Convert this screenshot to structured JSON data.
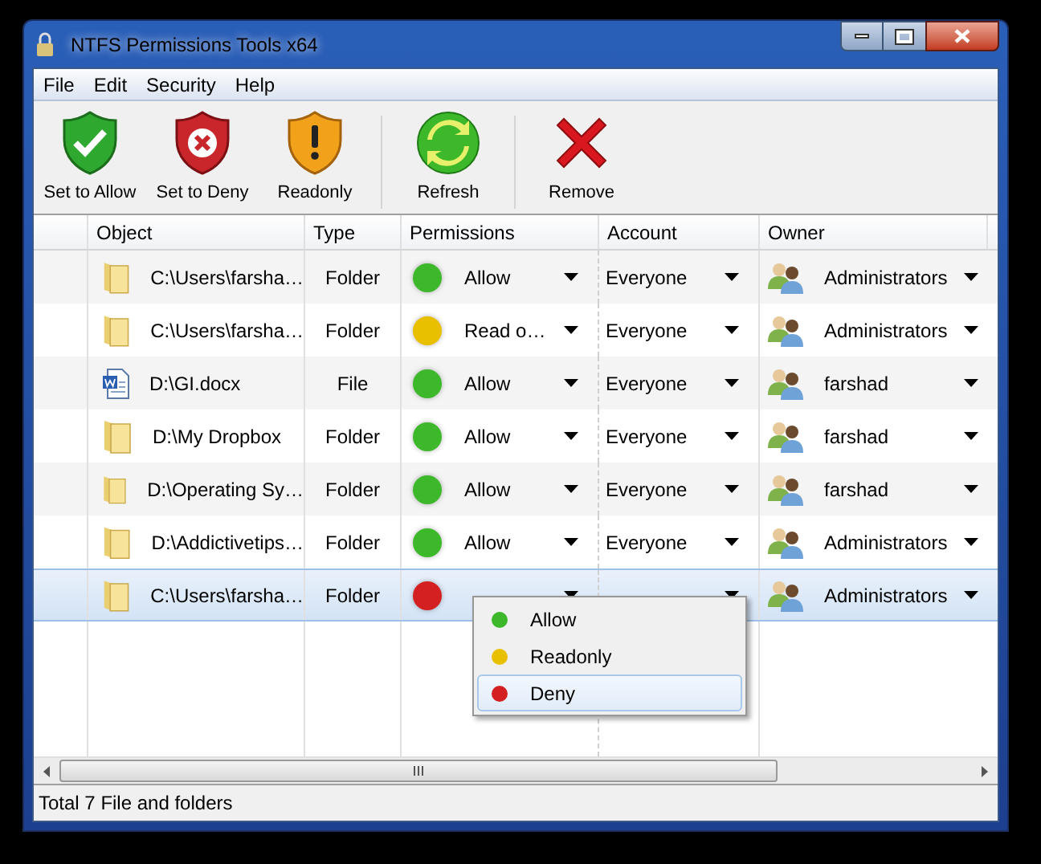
{
  "window": {
    "title": "NTFS Permissions Tools x64"
  },
  "menu": [
    "File",
    "Edit",
    "Security",
    "Help"
  ],
  "toolbar": [
    {
      "kind": "allow",
      "label": "Set to Allow"
    },
    {
      "kind": "deny",
      "label": "Set to Deny"
    },
    {
      "kind": "readonly",
      "label": "Readonly"
    },
    {
      "kind": "refresh",
      "label": "Refresh"
    },
    {
      "kind": "remove",
      "label": "Remove"
    }
  ],
  "table": {
    "columns": [
      "Object",
      "Type",
      "Permissions",
      "Account",
      "Owner"
    ],
    "rows": [
      {
        "kind": "folder",
        "object": "C:\\Users\\farsha…",
        "type": "Folder",
        "permission": "Allow",
        "color": "#3cb82a",
        "account": "Everyone",
        "owner": "Administrators",
        "selected": false
      },
      {
        "kind": "folder",
        "object": "C:\\Users\\farsha…",
        "type": "Folder",
        "permission": "Read o…",
        "color": "#e8c000",
        "account": "Everyone",
        "owner": "Administrators",
        "selected": false
      },
      {
        "kind": "document",
        "object": "D:\\GI.docx",
        "type": "File",
        "permission": "Allow",
        "color": "#3cb82a",
        "account": "Everyone",
        "owner": "farshad",
        "selected": false
      },
      {
        "kind": "folder",
        "object": "D:\\My Dropbox",
        "type": "Folder",
        "permission": "Allow",
        "color": "#3cb82a",
        "account": "Everyone",
        "owner": "farshad",
        "selected": false
      },
      {
        "kind": "folder",
        "object": "D:\\Operating Sy…",
        "type": "Folder",
        "permission": "Allow",
        "color": "#3cb82a",
        "account": "Everyone",
        "owner": "farshad",
        "selected": false
      },
      {
        "kind": "folder",
        "object": "D:\\Addictivetips…",
        "type": "Folder",
        "permission": "Allow",
        "color": "#3cb82a",
        "account": "Everyone",
        "owner": "Administrators",
        "selected": false
      },
      {
        "kind": "folder",
        "object": "C:\\Users\\farsha…",
        "type": "Folder",
        "color": "#d42020",
        "owner": "Administrators",
        "selected": true
      }
    ]
  },
  "dropdown_menu": [
    {
      "label": "Allow",
      "color": "#3cb82a",
      "selected": false
    },
    {
      "label": "Readonly",
      "color": "#e8c000",
      "selected": false
    },
    {
      "label": "Deny",
      "color": "#d42020",
      "selected": true
    }
  ],
  "status_bar": "Total 7 File and folders"
}
